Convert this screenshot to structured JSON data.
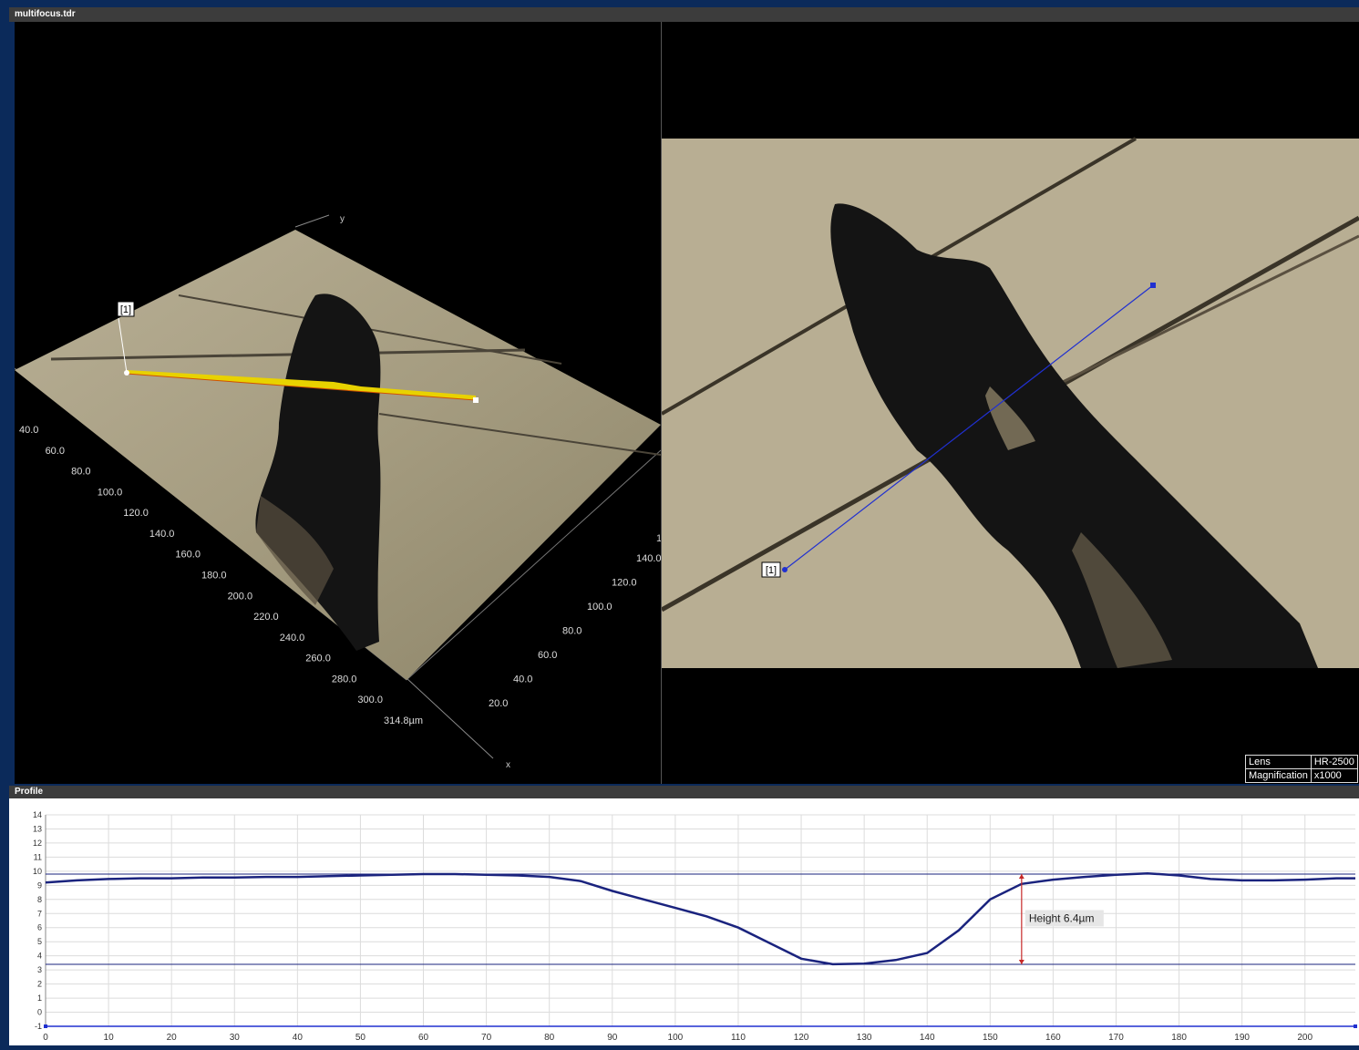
{
  "window": {
    "title": "multifocus.tdr"
  },
  "view3d": {
    "axis_y_label": "y",
    "axis_x_label": "x",
    "marker_label": "[1]",
    "left_ticks": [
      "40.0",
      "60.0",
      "80.0",
      "100.0",
      "120.0",
      "140.0",
      "160.0",
      "180.0",
      "200.0",
      "220.0",
      "240.0",
      "260.0",
      "280.0",
      "300.0",
      "314.8µm"
    ],
    "right_ticks": [
      "140.0",
      "120.0",
      "100.0",
      "80.0",
      "60.0",
      "40.0",
      "20.0"
    ],
    "edge_fragment": "1"
  },
  "view2d": {
    "marker_label": "[1]",
    "info": [
      {
        "key": "Lens",
        "value": "HR-2500"
      },
      {
        "key": "Magnification",
        "value": "x1000"
      }
    ]
  },
  "profile": {
    "title": "Profile",
    "height_label": "Height 6.4µm",
    "colors": {
      "line": "#1a237e",
      "height_marker": "#c62828",
      "grid": "#dcdcdc"
    },
    "chart_data": {
      "type": "line",
      "xlim": [
        0,
        208
      ],
      "ylim": [
        -1,
        14
      ],
      "x_ticks": [
        0,
        10,
        20,
        30,
        40,
        50,
        60,
        70,
        80,
        90,
        100,
        110,
        120,
        130,
        140,
        150,
        160,
        170,
        180,
        190,
        200
      ],
      "y_ticks": [
        -1,
        0,
        1,
        2,
        3,
        4,
        5,
        6,
        7,
        8,
        9,
        10,
        11,
        12,
        13,
        14
      ],
      "reference_lines": [
        9.8,
        3.4
      ],
      "height_measurement": {
        "x": 155,
        "y_top": 9.8,
        "y_bottom": 3.4,
        "value": 6.4
      },
      "series": [
        {
          "x": [
            0,
            5,
            10,
            15,
            20,
            25,
            30,
            35,
            40,
            45,
            50,
            55,
            60,
            65,
            70,
            75,
            80,
            85,
            90,
            95,
            100,
            105,
            110,
            115,
            120,
            125,
            130,
            135,
            140,
            145,
            150,
            155,
            160,
            165,
            170,
            175,
            180,
            185,
            190,
            195,
            200,
            205,
            208
          ],
          "y": [
            9.2,
            9.35,
            9.45,
            9.5,
            9.5,
            9.55,
            9.55,
            9.6,
            9.6,
            9.65,
            9.7,
            9.75,
            9.8,
            9.8,
            9.75,
            9.7,
            9.6,
            9.3,
            8.6,
            8.0,
            7.4,
            6.8,
            6.0,
            4.9,
            3.8,
            3.4,
            3.45,
            3.7,
            4.2,
            5.8,
            8.0,
            9.1,
            9.4,
            9.6,
            9.75,
            9.85,
            9.7,
            9.45,
            9.35,
            9.35,
            9.4,
            9.5,
            9.5
          ]
        }
      ]
    }
  }
}
